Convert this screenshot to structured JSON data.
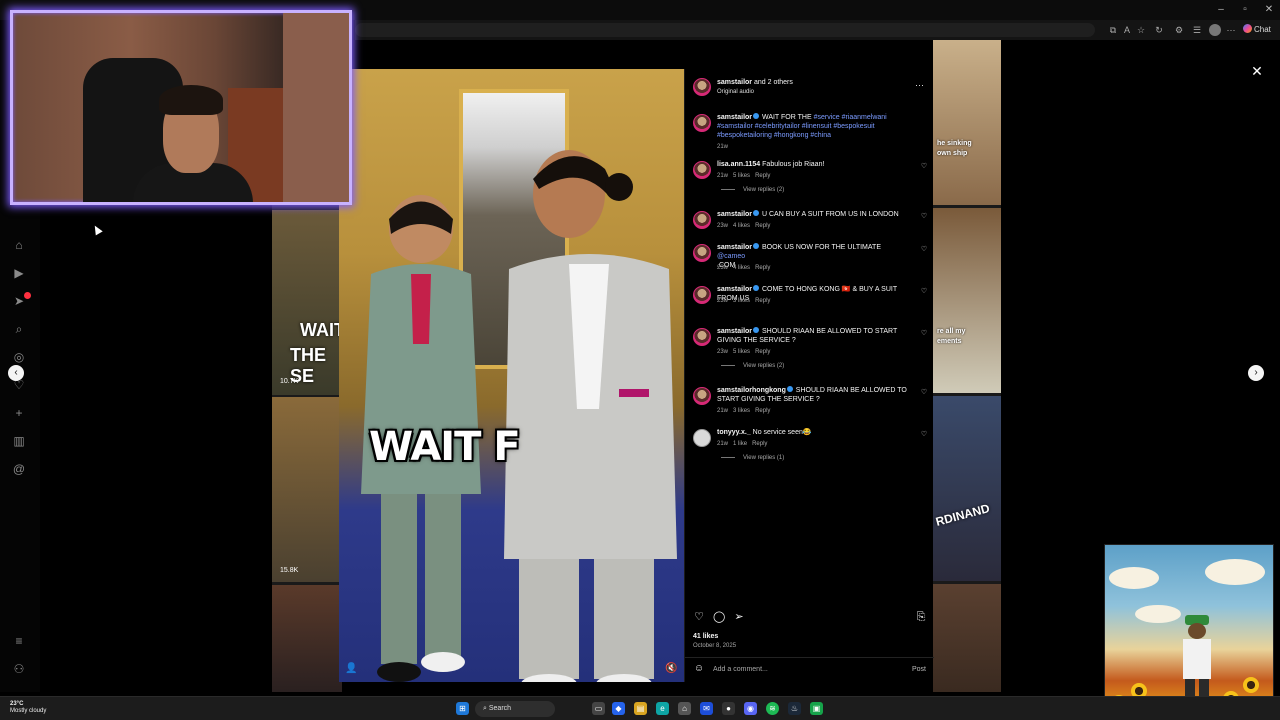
{
  "browser": {
    "chat_label": "Chat"
  },
  "reel": {
    "overlay_text": "WAIT F",
    "header": {
      "author": "samstailor",
      "coauthors": " and 2 others",
      "audio": "Original audio",
      "more": "···"
    },
    "caption": {
      "user": "samstailor",
      "text": " WAIT FOR THE ",
      "hashtags": "#service #riaanmelwani #samstailor #celebritytailor #linensuit #bespokesuit #bespoketailoring #hongkong #china",
      "time": "21w"
    },
    "comments": [
      {
        "user": "lisa.ann.1154",
        "verified": false,
        "text": " Fabulous job Riaan!",
        "time": "21w",
        "likes": "5 likes",
        "reply": "Reply",
        "view_replies": "View replies (2)"
      },
      {
        "user": "samstailor",
        "verified": true,
        "text": " U CAN BUY A SUIT FROM US IN LONDON",
        "time": "23w",
        "likes": "4 likes",
        "reply": "Reply",
        "view_replies": ""
      },
      {
        "user": "samstailor",
        "verified": true,
        "text": " BOOK US NOW FOR THE ULTIMATE ",
        "mention": "@cameo",
        "tail": ".COM",
        "time": "23w",
        "likes": "4 likes",
        "reply": "Reply",
        "view_replies": ""
      },
      {
        "user": "samstailor",
        "verified": true,
        "text": " COME TO HONG KONG 🇭🇰 & BUY A SUIT FROM US",
        "time": "23w",
        "likes": "3 likes",
        "reply": "Reply",
        "view_replies": ""
      },
      {
        "user": "samstailor",
        "verified": true,
        "text": " SHOULD RIAAN BE ALLOWED TO START GIVING THE SERVICE ?",
        "time": "23w",
        "likes": "5 likes",
        "reply": "Reply",
        "view_replies": "View replies (2)"
      },
      {
        "user": "samstailorhongkong",
        "verified": true,
        "text": " SHOULD RIAAN BE ALLOWED TO START GIVING THE SERVICE ?",
        "time": "21w",
        "likes": "3 likes",
        "reply": "Reply",
        "view_replies": ""
      },
      {
        "user": "tonyyy.x._",
        "verified": false,
        "text": " No service seen😂",
        "time": "21w",
        "likes": "1 like",
        "reply": "Reply",
        "view_replies": "View replies (1)"
      }
    ],
    "likes_count": "41 likes",
    "date": "October 8, 2025",
    "add_comment_placeholder": "Add a comment...",
    "post_label": "Post"
  },
  "background_tiles": {
    "left_text_1": "WAIT",
    "left_text_2": "THE SE",
    "left_views_1": "10.7K",
    "left_views_2": "15.8K",
    "right_text_1": "he sinking",
    "right_text_2": "own ship",
    "right_text_3": "re all my",
    "right_text_4": "ements",
    "right_text_5": "RDINAND"
  },
  "taskbar": {
    "temperature": "23°C",
    "weather_desc": "Mostly cloudy",
    "search_label": "Search"
  },
  "colors": {
    "accent_purple": "#7d5cff",
    "link_blue": "#7b9bff",
    "notification_red": "#ff3040"
  }
}
